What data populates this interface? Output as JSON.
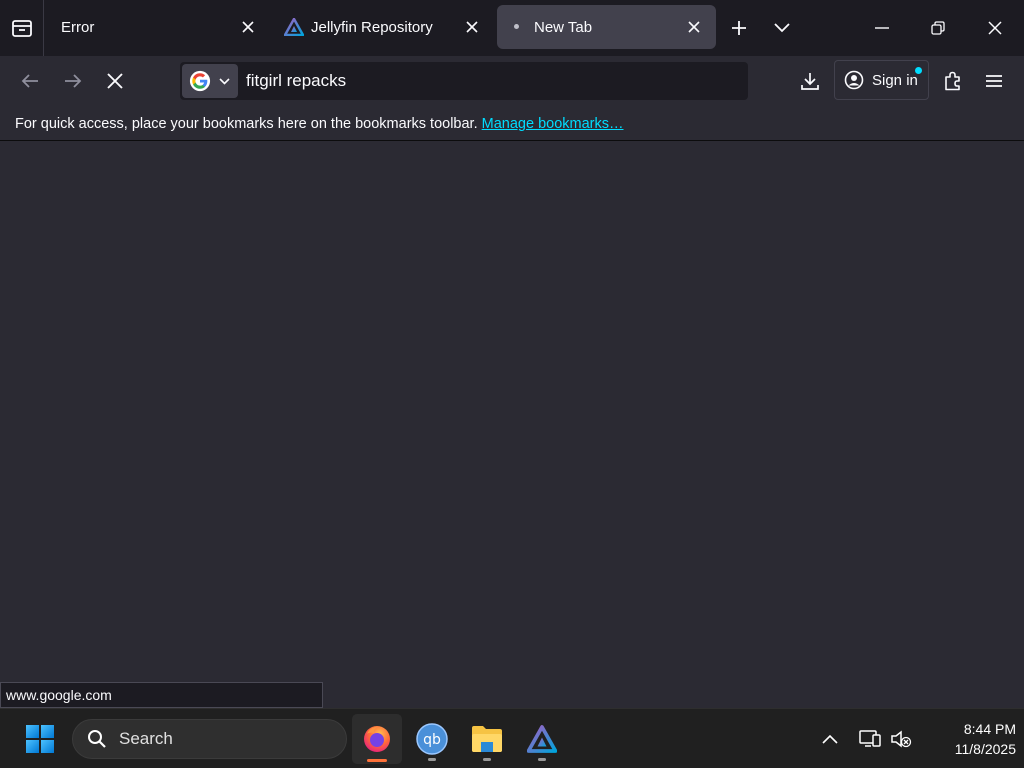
{
  "tabs": [
    {
      "label": "Error"
    },
    {
      "label": "Jellyfin Repository"
    },
    {
      "label": "New Tab"
    }
  ],
  "url_bar": {
    "value": "fitgirl repacks",
    "engine": "Google"
  },
  "toolbar": {
    "signin_label": "Sign in"
  },
  "bookmarks": {
    "message": "For quick access, place your bookmarks here on the bookmarks toolbar.",
    "link": "Manage bookmarks…"
  },
  "status": {
    "url": "www.google.com"
  },
  "taskbar": {
    "search_label": "Search",
    "time": "8:44 PM",
    "date": "11/8/2025"
  },
  "colors": {
    "accent": "#00ddff",
    "firefox_active": "#ff7139"
  }
}
